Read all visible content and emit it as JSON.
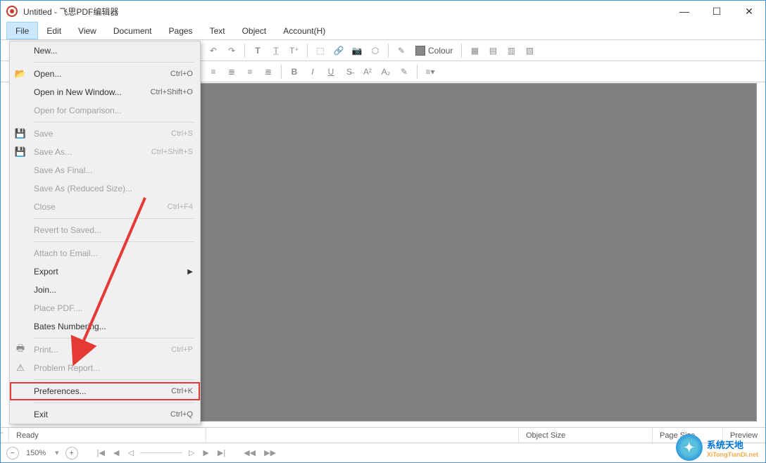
{
  "window": {
    "title": "Untitled  -  飞思PDF编辑器"
  },
  "menubar": [
    "File",
    "Edit",
    "View",
    "Document",
    "Pages",
    "Text",
    "Object",
    "Account(H)"
  ],
  "toolbar": {
    "colour_label": "Colour"
  },
  "file_menu": {
    "new": "New...",
    "open": "Open...",
    "open_sc": "Ctrl+O",
    "open_new_window": "Open in New Window...",
    "open_new_window_sc": "Ctrl+Shift+O",
    "open_comparison": "Open for Comparison...",
    "save": "Save",
    "save_sc": "Ctrl+S",
    "save_as": "Save As...",
    "save_as_sc": "Ctrl+Shift+S",
    "save_final": "Save As Final...",
    "save_reduced": "Save As (Reduced Size)...",
    "close": "Close",
    "close_sc": "Ctrl+F4",
    "revert": "Revert to Saved...",
    "attach_email": "Attach to Email...",
    "export": "Export",
    "join": "Join...",
    "place_pdf": "Place PDF....",
    "bates": "Bates Numbering...",
    "print": "Print...",
    "print_sc": "Ctrl+P",
    "problem_report": "Problem Report...",
    "preferences": "Preferences...",
    "preferences_sc": "Ctrl+K",
    "exit": "Exit",
    "exit_sc": "Ctrl+Q"
  },
  "statusbar": {
    "ready": "Ready",
    "object_size": "Object Size",
    "page_size": "Page Size",
    "preview": "Preview"
  },
  "bottombar": {
    "zoom": "150%"
  },
  "watermark": {
    "line1": "系统天地",
    "line2": "XiTongTianDi.net"
  }
}
